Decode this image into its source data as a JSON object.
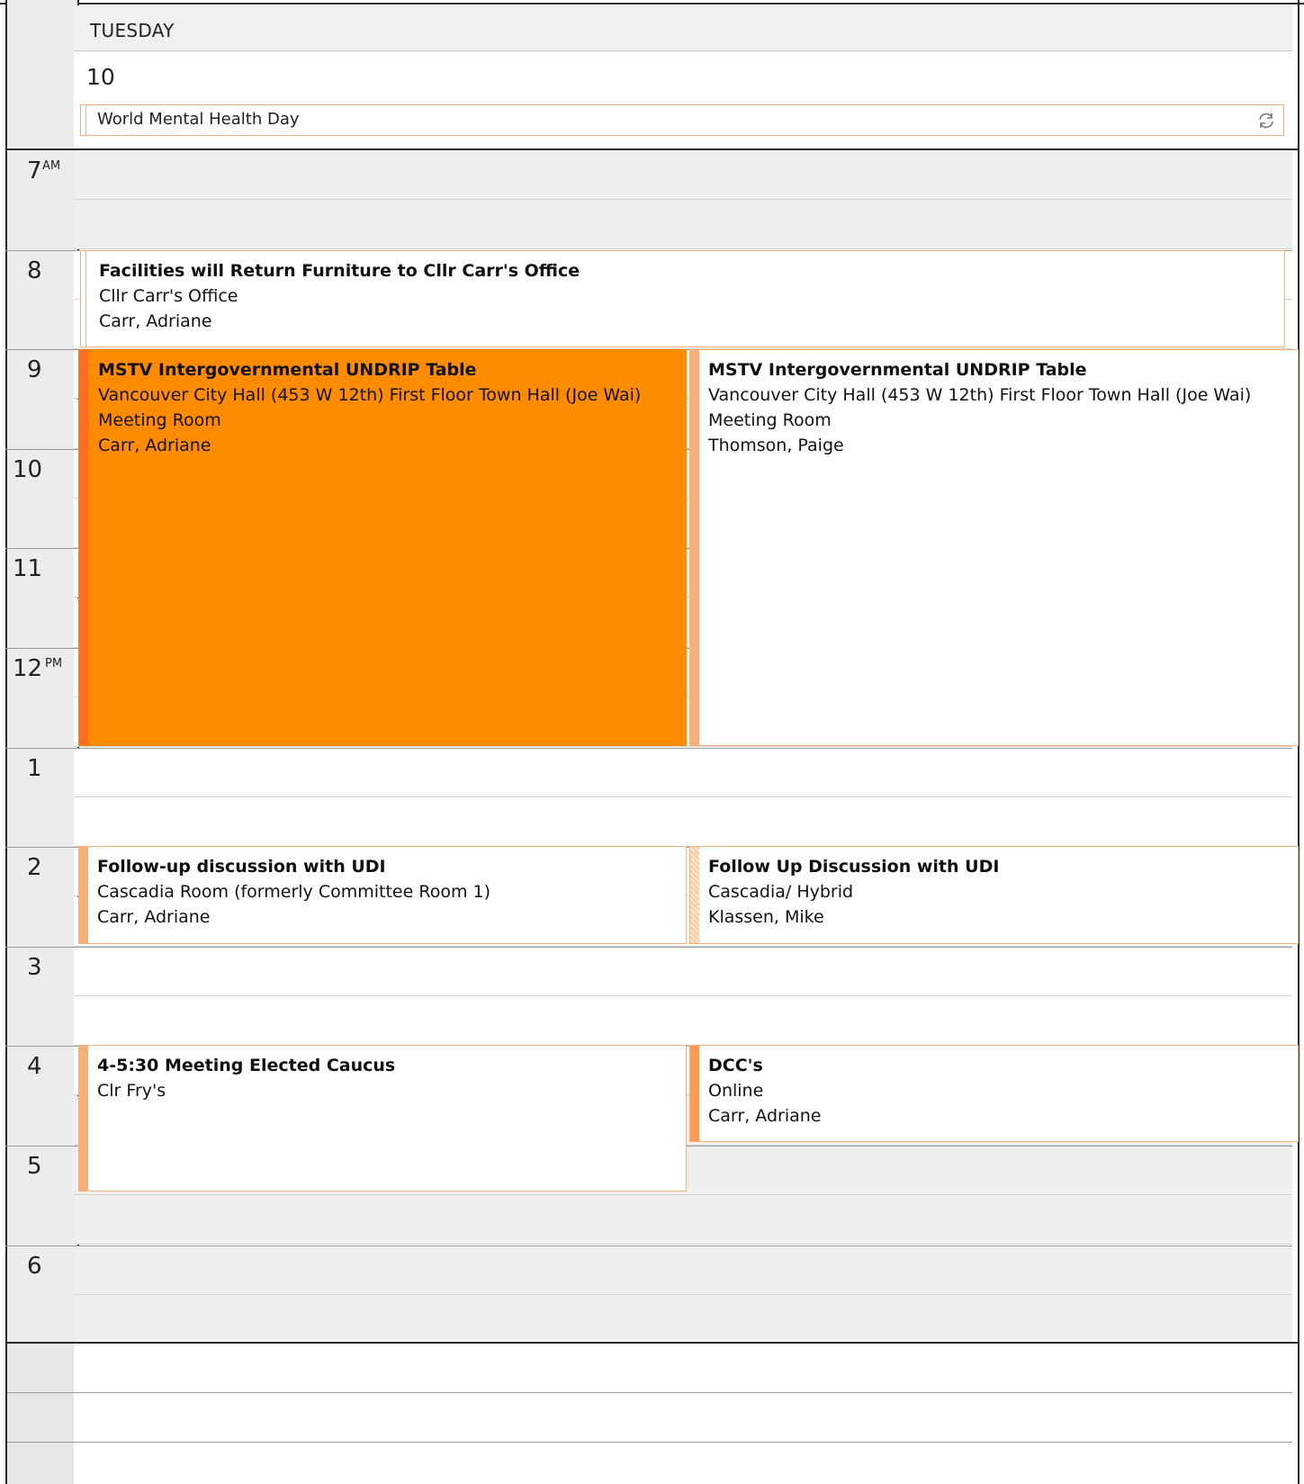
{
  "day": {
    "name": "TUESDAY",
    "date": "10"
  },
  "allday_event": {
    "title": "World Mental Health Day",
    "icon": "sync-icon"
  },
  "hours": [
    {
      "n": "7",
      "ap": "AM"
    },
    {
      "n": "8",
      "ap": ""
    },
    {
      "n": "9",
      "ap": ""
    },
    {
      "n": "10",
      "ap": ""
    },
    {
      "n": "11",
      "ap": ""
    },
    {
      "n": "12",
      "ap": "PM"
    },
    {
      "n": "1",
      "ap": ""
    },
    {
      "n": "2",
      "ap": ""
    },
    {
      "n": "3",
      "ap": ""
    },
    {
      "n": "4",
      "ap": ""
    },
    {
      "n": "5",
      "ap": ""
    },
    {
      "n": "6",
      "ap": ""
    }
  ],
  "events": {
    "facilities": {
      "title": "Facilities will Return Furniture to Cllr Carr's Office",
      "location": "Cllr Carr's Office",
      "organizer": "Carr, Adriane"
    },
    "mstv_carr": {
      "title": "MSTV Intergovernmental UNDRIP Table",
      "location": "Vancouver City Hall (453 W 12th) First Floor Town Hall (Joe Wai)",
      "location2": "Meeting Room",
      "organizer": "Carr, Adriane"
    },
    "mstv_thomson": {
      "title": "MSTV Intergovernmental UNDRIP Table",
      "location": "Vancouver City Hall (453 W 12th) First Floor Town Hall (Joe Wai)",
      "location2": "Meeting Room",
      "organizer": "Thomson, Paige"
    },
    "udi_carr": {
      "title": "Follow-up discussion with UDI",
      "location": "Cascadia Room (formerly Committee Room 1)",
      "organizer": "Carr, Adriane"
    },
    "udi_klassen": {
      "title": "Follow Up Discussion with UDI",
      "location": "Cascadia/ Hybrid",
      "organizer": "Klassen, Mike"
    },
    "caucus": {
      "title": "4-5:30 Meeting Elected Caucus",
      "location": "Clr Fry's"
    },
    "dcc": {
      "title": "DCC's",
      "location": "Online",
      "organizer": "Carr, Adriane"
    }
  },
  "colors": {
    "busy": "#ff8c00",
    "busy_bar": "#ff6a22",
    "tentative_bar": "#f8b07a",
    "border": "#f6b07a"
  }
}
